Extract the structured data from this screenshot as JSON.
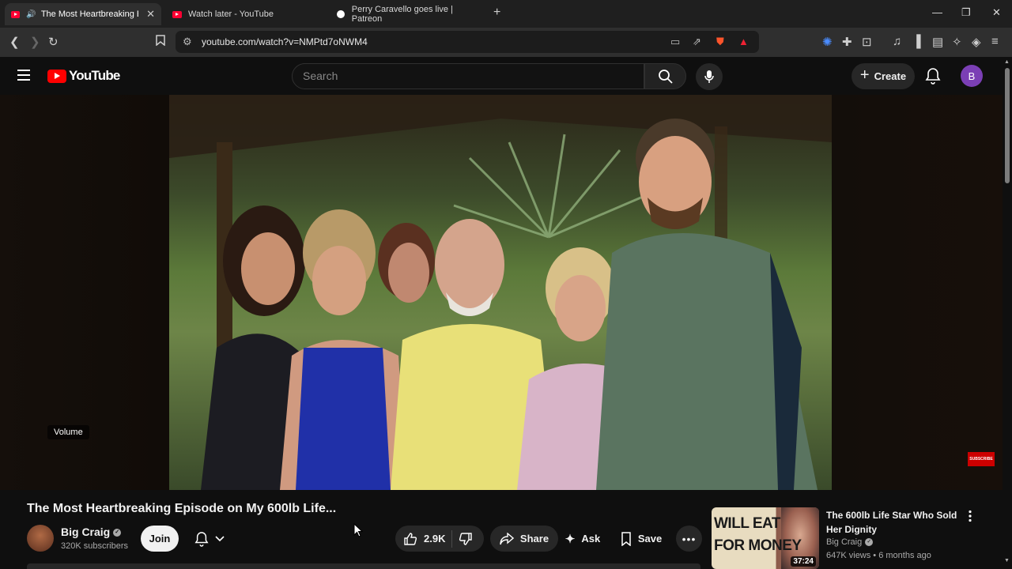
{
  "browser": {
    "tabs": [
      {
        "title": "The Most Heartbreaking Episo",
        "active": true
      },
      {
        "title": "Watch later - YouTube",
        "active": false
      },
      {
        "title": "Perry Caravello goes live | Patreon",
        "active": false
      }
    ],
    "url": "youtube.com/watch?v=NMPtd7oNWM4"
  },
  "youtube": {
    "logo_text": "YouTube",
    "search_placeholder": "Search",
    "create_label": "Create",
    "avatar_letter": "B"
  },
  "player": {
    "volume_tooltip": "Volume",
    "watermark": "SUBSCRIBE"
  },
  "video": {
    "title": "The Most Heartbreaking Episode on My 600lb Life...",
    "channel": "Big Craig",
    "subscribers": "320K subscribers",
    "join_label": "Join",
    "likes": "2.9K",
    "share_label": "Share",
    "ask_label": "Ask",
    "save_label": "Save"
  },
  "recommendation": {
    "thumb_line1": "WILL EAT",
    "thumb_line2": "FOR MONEY",
    "duration": "37:24",
    "title": "The 600lb Life Star Who Sold Her Dignity",
    "channel": "Big Craig",
    "meta": "647K views • 6 months ago"
  }
}
